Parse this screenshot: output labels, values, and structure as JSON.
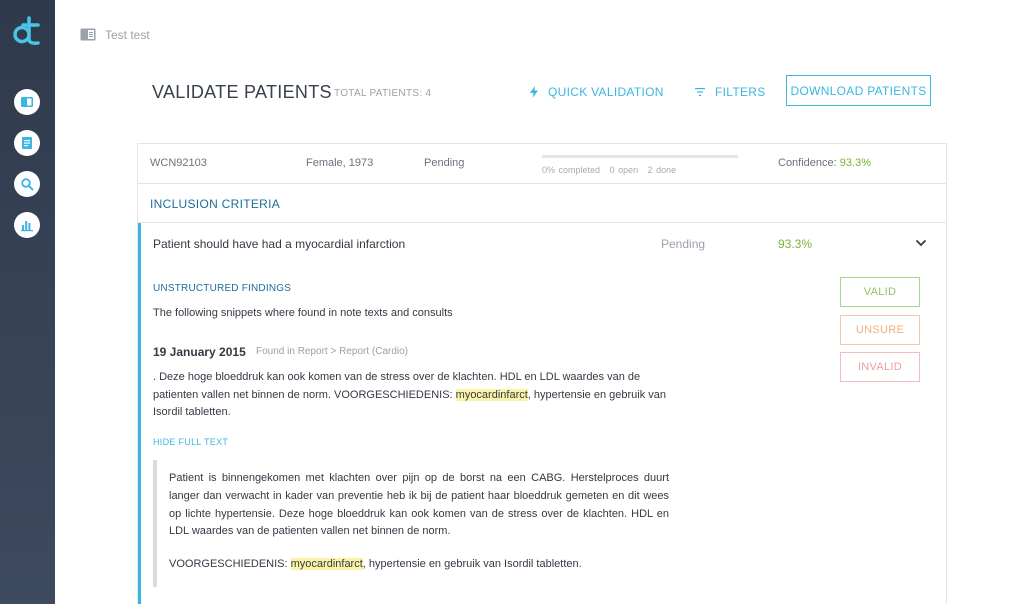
{
  "app": {
    "logo_glyph": "dt",
    "accent_color": "#3bb6e3"
  },
  "sidebar": {
    "items": [
      {
        "icon": "book-icon"
      },
      {
        "icon": "clipboard-icon"
      },
      {
        "icon": "search-icon"
      },
      {
        "icon": "bar-chart-icon"
      }
    ]
  },
  "breadcrumb": {
    "label": "Test test"
  },
  "header": {
    "title": "VALIDATE PATIENTS",
    "total_patients": "TOTAL PATIENTS: 4",
    "quick_validation": "QUICK VALIDATION",
    "filters": "FILTERS",
    "download": "DOWNLOAD PATIENTS"
  },
  "patient": {
    "id": "WCN92103",
    "demographics": "Female, 1973",
    "status": "Pending",
    "progress": {
      "fraction": 0,
      "completed": "0% completed",
      "open": "0 open",
      "done": "2 done"
    },
    "confidence_label": "Confidence:",
    "confidence_value": "93.3%"
  },
  "inclusion": {
    "section_label": "INCLUSION CRITERIA",
    "criterion": {
      "text": "Patient should have had a myocardial infarction",
      "status": "Pending",
      "confidence": "93.3%"
    },
    "findings": {
      "heading": "UNSTRUCTURED FINDINGS",
      "intro": "The following snippets where found in note texts and consults",
      "date": "19 January 2015",
      "found_in": "Found in Report > Report (Cardio)",
      "snippet_before": ". Deze hoge bloeddruk kan ook komen van de stress over de klachten. HDL en LDL waardes van de patienten vallen net binnen de norm. VOORGESCHIEDENIS: ",
      "snippet_highlight": "myocardinfarct",
      "snippet_after": ", hypertensie en gebruik van Isordil tabletten.",
      "hide_full_text": "HIDE FULL TEXT",
      "full_text_para1": "Patient is binnengekomen met klachten over pijn op de borst na een CABG. Herstelproces duurt langer dan verwacht in kader van preventie heb ik bij de patient haar bloeddruk gemeten en dit wees op lichte hypertensie. Deze hoge bloeddruk kan ook komen van de stress over de klachten. HDL en LDL waardes van de patienten vallen net binnen de norm.",
      "full_text_para2_before": "VOORGESCHIEDENIS: ",
      "full_text_para2_highlight": "myocardinfarct",
      "full_text_para2_after": ", hypertensie en gebruik van Isordil tabletten."
    },
    "actions": {
      "valid": "VALID",
      "unsure": "UNSURE",
      "invalid": "INVALID"
    }
  }
}
